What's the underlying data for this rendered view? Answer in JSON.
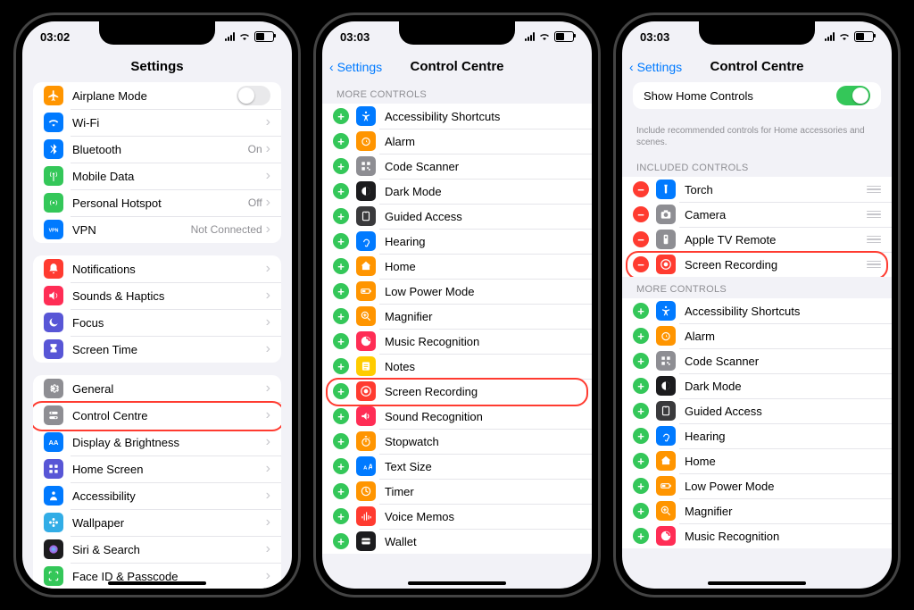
{
  "phone1": {
    "time": "03:02",
    "title": "Settings",
    "group1": [
      {
        "icon": "airplane",
        "col": "bg-orange",
        "label": "Airplane Mode",
        "type": "toggle",
        "on": false
      },
      {
        "icon": "wifi",
        "col": "bg-blue",
        "label": "Wi-Fi",
        "type": "link",
        "value": ""
      },
      {
        "icon": "bluetooth",
        "col": "bg-blue",
        "label": "Bluetooth",
        "type": "link",
        "value": "On"
      },
      {
        "icon": "antenna",
        "col": "bg-green",
        "label": "Mobile Data",
        "type": "link",
        "value": ""
      },
      {
        "icon": "hotspot",
        "col": "bg-green",
        "label": "Personal Hotspot",
        "type": "link",
        "value": "Off"
      },
      {
        "icon": "vpn",
        "col": "bg-blue",
        "label": "VPN",
        "type": "link",
        "value": "Not Connected"
      }
    ],
    "group2": [
      {
        "icon": "bell",
        "col": "bg-red",
        "label": "Notifications"
      },
      {
        "icon": "speaker",
        "col": "bg-pink",
        "label": "Sounds & Haptics"
      },
      {
        "icon": "moon",
        "col": "bg-indigo",
        "label": "Focus"
      },
      {
        "icon": "hourglass",
        "col": "bg-indigo",
        "label": "Screen Time"
      }
    ],
    "group3": [
      {
        "icon": "gear",
        "col": "bg-gray",
        "label": "General"
      },
      {
        "icon": "switches",
        "col": "bg-gray",
        "label": "Control Centre",
        "highlight": true
      },
      {
        "icon": "aa",
        "col": "bg-blue",
        "label": "Display & Brightness"
      },
      {
        "icon": "grid",
        "col": "bg-indigo",
        "label": "Home Screen"
      },
      {
        "icon": "person",
        "col": "bg-blue",
        "label": "Accessibility"
      },
      {
        "icon": "flower",
        "col": "bg-cyan",
        "label": "Wallpaper"
      },
      {
        "icon": "siri",
        "col": "bg-black",
        "label": "Siri & Search"
      },
      {
        "icon": "faceid",
        "col": "bg-green",
        "label": "Face ID & Passcode"
      }
    ]
  },
  "phone2": {
    "time": "03:03",
    "back": "Settings",
    "title": "Control Centre",
    "section_header": "MORE CONTROLS",
    "items": [
      {
        "icon": "access",
        "col": "bg-blue",
        "label": "Accessibility Shortcuts"
      },
      {
        "icon": "alarm",
        "col": "bg-orange",
        "label": "Alarm"
      },
      {
        "icon": "qr",
        "col": "bg-gray",
        "label": "Code Scanner"
      },
      {
        "icon": "dark",
        "col": "bg-black",
        "label": "Dark Mode"
      },
      {
        "icon": "guided",
        "col": "bg-dgray",
        "label": "Guided Access"
      },
      {
        "icon": "ear",
        "col": "bg-blue",
        "label": "Hearing"
      },
      {
        "icon": "home",
        "col": "bg-orange",
        "label": "Home"
      },
      {
        "icon": "battery",
        "col": "bg-orange",
        "label": "Low Power Mode"
      },
      {
        "icon": "magnify",
        "col": "bg-orange",
        "label": "Magnifier"
      },
      {
        "icon": "music",
        "col": "bg-pink",
        "label": "Music Recognition"
      },
      {
        "icon": "notes",
        "col": "bg-yellow",
        "label": "Notes"
      },
      {
        "icon": "record",
        "col": "bg-red",
        "label": "Screen Recording",
        "highlight": true
      },
      {
        "icon": "sound",
        "col": "bg-pink",
        "label": "Sound Recognition"
      },
      {
        "icon": "stopwatch",
        "col": "bg-orange",
        "label": "Stopwatch"
      },
      {
        "icon": "textsize",
        "col": "bg-blue",
        "label": "Text Size"
      },
      {
        "icon": "timer",
        "col": "bg-orange",
        "label": "Timer"
      },
      {
        "icon": "voice",
        "col": "bg-red",
        "label": "Voice Memos"
      },
      {
        "icon": "wallet",
        "col": "bg-black",
        "label": "Wallet"
      }
    ]
  },
  "phone3": {
    "time": "03:03",
    "back": "Settings",
    "title": "Control Centre",
    "show_home_label": "Show Home Controls",
    "show_home_on": true,
    "show_home_footer": "Include recommended controls for Home accessories and scenes.",
    "included_header": "INCLUDED CONTROLS",
    "included": [
      {
        "icon": "torch",
        "col": "bg-blue",
        "label": "Torch"
      },
      {
        "icon": "camera",
        "col": "bg-gray",
        "label": "Camera"
      },
      {
        "icon": "remote",
        "col": "bg-gray",
        "label": "Apple TV Remote"
      },
      {
        "icon": "record",
        "col": "bg-red",
        "label": "Screen Recording",
        "highlight": true
      }
    ],
    "more_header": "MORE CONTROLS",
    "more": [
      {
        "icon": "access",
        "col": "bg-blue",
        "label": "Accessibility Shortcuts"
      },
      {
        "icon": "alarm",
        "col": "bg-orange",
        "label": "Alarm"
      },
      {
        "icon": "qr",
        "col": "bg-gray",
        "label": "Code Scanner"
      },
      {
        "icon": "dark",
        "col": "bg-black",
        "label": "Dark Mode"
      },
      {
        "icon": "guided",
        "col": "bg-dgray",
        "label": "Guided Access"
      },
      {
        "icon": "ear",
        "col": "bg-blue",
        "label": "Hearing"
      },
      {
        "icon": "home",
        "col": "bg-orange",
        "label": "Home"
      },
      {
        "icon": "battery",
        "col": "bg-orange",
        "label": "Low Power Mode"
      },
      {
        "icon": "magnify",
        "col": "bg-orange",
        "label": "Magnifier"
      },
      {
        "icon": "music",
        "col": "bg-pink",
        "label": "Music Recognition"
      }
    ]
  }
}
